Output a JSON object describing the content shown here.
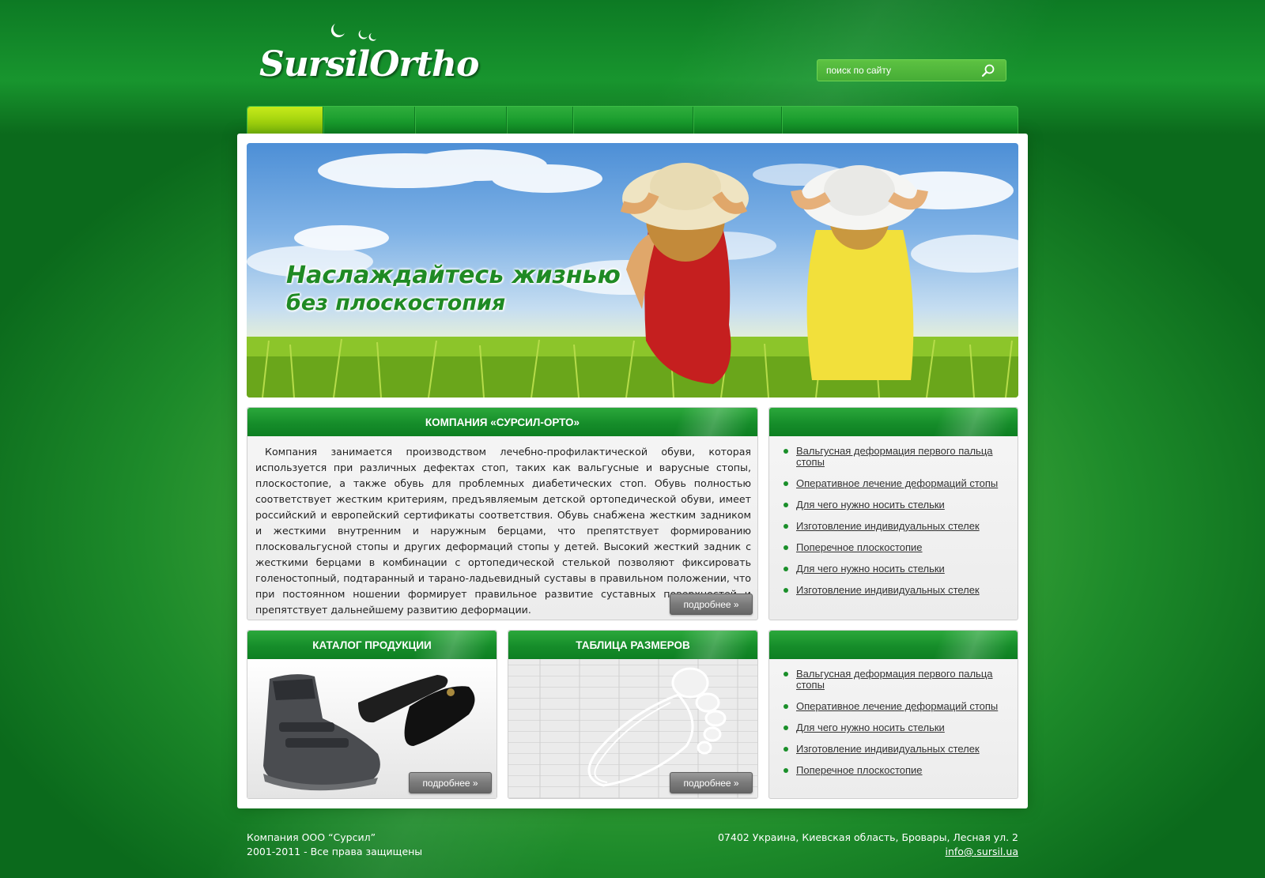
{
  "brand": {
    "logo_text": "SursilOrtho"
  },
  "search": {
    "placeholder": "поиск по сайту"
  },
  "nav": {
    "items": [
      "",
      "",
      "",
      "",
      "",
      "",
      ""
    ]
  },
  "banner": {
    "line1": "Наслаждайтесь жизнью",
    "line2": "без плоскостопия"
  },
  "about": {
    "title": "КОМПАНИЯ «СУРСИЛ-ОРТО»",
    "text": "Компания  занимается производством лечебно-профилактической обуви, которая используется при различных дефектах стоп, таких как вальгусные и варусные стопы, плоскостопие, а также обувь для проблемных диабетических стоп. Обувь полностью соответствует жестким критериям, предъявляемым детской ортопедической обуви, имеет российский и европейский сертификаты соответствия. Обувь снабжена жестким задником и жесткими внутренним и наружным берцами, что препятствует формированию плосковальгусной стопы и других деформаций стопы у детей. Высокий жесткий задник с жесткими берцами в комбинации с ортопедической стелькой позволяют фиксировать голеностопный, подтаранный и тарано-ладьевидный суставы в правильном положении, что при постоянном ношении формирует правильное развитие суставных поверхностей и препятствует дальнейшему развитию деформации.",
    "more": "подробнее »"
  },
  "sidebar_top": {
    "title": "",
    "links": [
      "Вальгусная деформация первого пальца стопы",
      "Оперативное лечение деформаций стопы",
      "Для чего нужно носить стельки",
      "Изготовление индивидуальных стелек",
      "Поперечное плоскостопие",
      "Для чего нужно носить стельки",
      "Изготовление индивидуальных стелек"
    ]
  },
  "catalog": {
    "title": "КАТАЛОГ ПРОДУКЦИИ",
    "more": "подробнее »"
  },
  "sizes": {
    "title": "ТАБЛИЦА РАЗМЕРОВ",
    "more": "подробнее »"
  },
  "sidebar_bottom": {
    "title": "",
    "links": [
      "Вальгусная деформация первого пальца стопы",
      "Оперативное лечение деформаций стопы",
      "Для чего нужно носить стельки",
      "Изготовление индивидуальных стелек",
      "Поперечное плоскостопие"
    ]
  },
  "footer": {
    "company": "Компания ООО “Сурсил”",
    "copyright": "2001-2011 - Все права защищены",
    "address": "07402 Украина, Киевская область, Бровары, Лесная ул. 2",
    "email": "info@.sursil.ua"
  },
  "colors": {
    "brand_green": "#168d2a",
    "nav_active": "#9fd10d",
    "button_gray": "#7a7a7a"
  }
}
